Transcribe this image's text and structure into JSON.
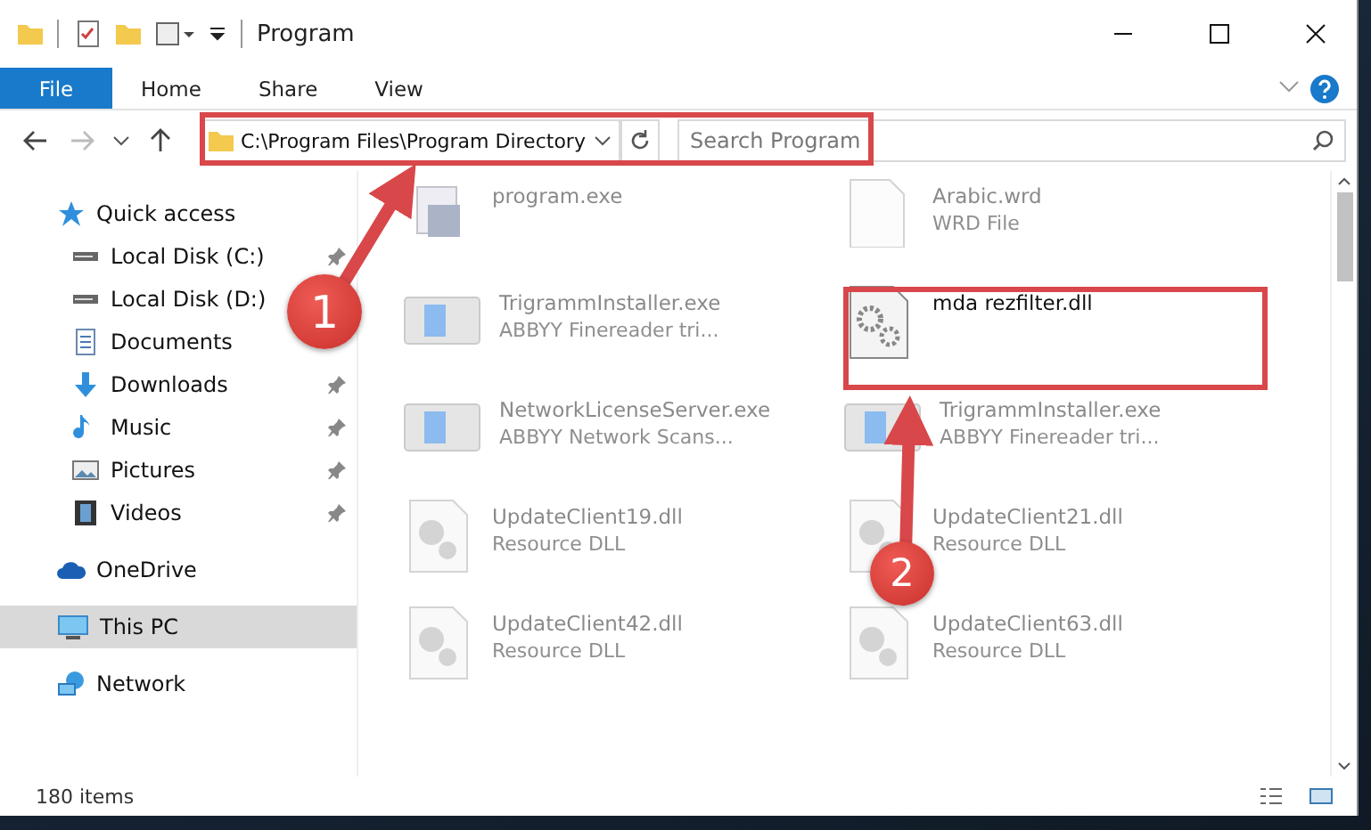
{
  "window": {
    "title": "Program"
  },
  "ribbon_tabs": [
    {
      "label": "File",
      "selected": true
    },
    {
      "label": "Home",
      "selected": false
    },
    {
      "label": "Share",
      "selected": false
    },
    {
      "label": "View",
      "selected": false
    }
  ],
  "address": {
    "path": "C:\\Program Files\\Program Directory"
  },
  "search": {
    "placeholder": "Search Program"
  },
  "sidebar": {
    "items": [
      {
        "label": "Quick access",
        "kind": "star",
        "selected": false,
        "children": [
          {
            "label": "Local Disk (C:)",
            "kind": "drive",
            "pinned": true,
            "selected": false
          },
          {
            "label": "Local Disk (D:)",
            "kind": "drive",
            "pinned": false,
            "selected": false
          },
          {
            "label": "Documents",
            "kind": "document",
            "pinned": false,
            "selected": false
          },
          {
            "label": "Downloads",
            "kind": "download",
            "pinned": true,
            "selected": false
          },
          {
            "label": "Music",
            "kind": "music",
            "pinned": true,
            "selected": false
          },
          {
            "label": "Pictures",
            "kind": "pictures",
            "pinned": true,
            "selected": false
          },
          {
            "label": "Videos",
            "kind": "videos",
            "pinned": true,
            "selected": false
          }
        ]
      },
      {
        "label": "OneDrive",
        "kind": "cloud",
        "selected": false
      },
      {
        "label": "This PC",
        "kind": "pc",
        "selected": true
      },
      {
        "label": "Network",
        "kind": "network",
        "selected": false
      }
    ]
  },
  "files": [
    {
      "name": "program.exe",
      "kind": "program",
      "dimmed": true
    },
    {
      "name": "Arabic.wrd",
      "description": "WRD File",
      "kind": "blank",
      "dimmed": true
    },
    {
      "name": "TrigrammInstaller.exe",
      "description": "ABBYY Finereader tri...",
      "kind": "app",
      "dimmed": true
    },
    {
      "name": "mda rezfilter.dll",
      "kind": "settings",
      "dimmed": false
    },
    {
      "name": "NetworkLicenseServer.exe",
      "description": "ABBYY Network Scans...",
      "kind": "app",
      "dimmed": true
    },
    {
      "name": "TrigrammInstaller.exe",
      "description": "ABBYY Finereader tri...",
      "kind": "app",
      "dimmed": true
    },
    {
      "name": "UpdateClient19.dll",
      "description": "Resource DLL",
      "kind": "dll",
      "dimmed": true
    },
    {
      "name": "UpdateClient21.dll",
      "description": "Resource DLL",
      "kind": "dll",
      "dimmed": true
    },
    {
      "name": "UpdateClient42.dll",
      "description": "Resource DLL",
      "kind": "dll",
      "dimmed": true
    },
    {
      "name": "UpdateClient63.dll",
      "description": "Resource DLL",
      "kind": "dll",
      "dimmed": true
    }
  ],
  "status_bar": {
    "count": "180 items"
  },
  "annotations": [
    {
      "number": "1"
    },
    {
      "number": "2"
    }
  ]
}
